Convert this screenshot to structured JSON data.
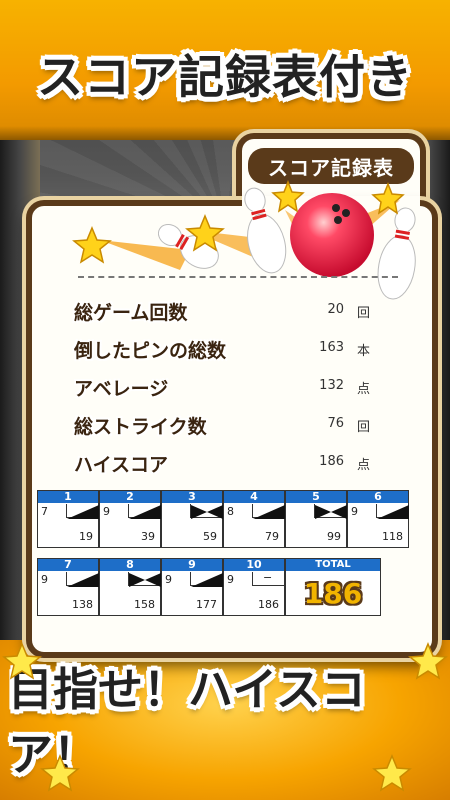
{
  "headline": "スコア記録表付き",
  "card": {
    "tab_title": "スコア記録表"
  },
  "stats": [
    {
      "label": "総ゲーム回数",
      "value": "20",
      "unit": "回"
    },
    {
      "label": "倒したピンの総数",
      "value": "163",
      "unit": "本"
    },
    {
      "label": "アベレージ",
      "value": "132",
      "unit": "点"
    },
    {
      "label": "総ストライク数",
      "value": "76",
      "unit": "回"
    },
    {
      "label": "ハイスコア",
      "value": "186",
      "unit": "点"
    }
  ],
  "scoresheet": {
    "row1": [
      {
        "frame": "1",
        "roll": "7",
        "mark": "spare",
        "cumulative": "19"
      },
      {
        "frame": "2",
        "roll": "9",
        "mark": "spare",
        "cumulative": "39"
      },
      {
        "frame": "3",
        "roll": "",
        "mark": "strike",
        "cumulative": "59"
      },
      {
        "frame": "4",
        "roll": "8",
        "mark": "spare",
        "cumulative": "79"
      },
      {
        "frame": "5",
        "roll": "",
        "mark": "strike",
        "cumulative": "99"
      },
      {
        "frame": "6",
        "roll": "9",
        "mark": "spare",
        "cumulative": "118"
      }
    ],
    "row2": [
      {
        "frame": "7",
        "roll": "9",
        "mark": "spare",
        "cumulative": "138"
      },
      {
        "frame": "8",
        "roll": "",
        "mark": "strike",
        "cumulative": "158"
      },
      {
        "frame": "9",
        "roll": "9",
        "mark": "spare",
        "cumulative": "177"
      },
      {
        "frame": "10",
        "roll": "9",
        "mark": "miss",
        "roll2": "−",
        "cumulative": "186"
      }
    ],
    "total_label": "TOTAL",
    "total_value": "186"
  },
  "footline": "目指せ！ハイスコア！",
  "colors": {
    "brand_orange": "#f39a00",
    "frame_blue": "#1e6ec8",
    "card_border": "#5a3a1a",
    "total_gold": "#f2b400"
  },
  "icons": [
    "star-icon",
    "bowling-ball-icon",
    "bowling-pin-icon"
  ]
}
